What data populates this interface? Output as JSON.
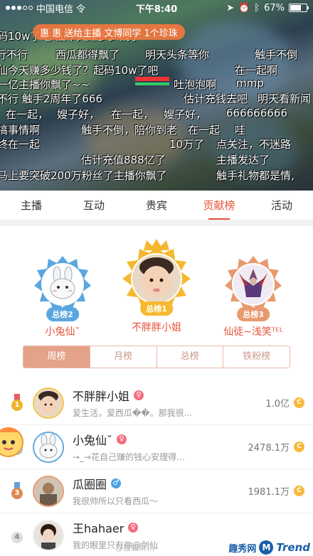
{
  "status_bar": {
    "carrier": "中国电信",
    "network": "令",
    "time": "下午8:40",
    "battery": "67%",
    "battery_level": 0.67
  },
  "video": {
    "gift_banner": "惠 惠 送给主播 文博同学 1个珍珠",
    "danmu": [
      "码10w了吧 仙今天赚多少钱了",
      "行不行",
      "西瓜都得飘了",
      "明天头条等你",
      "触手不倒",
      "仙今天赚多少钱了？起码10w了吧",
      "在一起啊",
      "一亿主播你飘了~~",
      "吐泡泡啊",
      "mmp",
      "不行 触手2周年了666",
      "估计充钱去吧",
      "明天看新闻",
      "在一起，",
      "嫂子好，",
      "在一起，",
      "嫂子好，",
      "666666666",
      "搞事情啊",
      "触手不倒，陪你到老",
      "在一起",
      "哇",
      "终在一起",
      "10万了",
      "点关注，不迷路",
      "估计充值888亿了",
      "主播发达了",
      "马上要突破200万粉丝了主播你飘了",
      "触手礼物都是情,"
    ]
  },
  "tabs": [
    {
      "label": "主播",
      "active": false
    },
    {
      "label": "互动",
      "active": false
    },
    {
      "label": "贵宾",
      "active": false
    },
    {
      "label": "贡献榜",
      "active": true
    },
    {
      "label": "活动",
      "active": false
    }
  ],
  "podium": [
    {
      "rank_label": "总榜2",
      "name": "小兔仙˘",
      "color": "#5aa7e0"
    },
    {
      "rank_label": "总榜1",
      "name": "不胖胖小姐",
      "color": "#f5b82e"
    },
    {
      "rank_label": "总榜3",
      "name": "仙徒~浅笑ᵀᴱᴸ",
      "color": "#e79a6f"
    }
  ],
  "sub_tabs": [
    {
      "label": "周榜",
      "active": true
    },
    {
      "label": "月榜",
      "active": false
    },
    {
      "label": "总榜",
      "active": false
    },
    {
      "label": "铁粉榜",
      "active": false
    }
  ],
  "list": [
    {
      "rank": "1",
      "name": "不胖胖小姐",
      "gender": "female",
      "gender_symbol": "♀",
      "desc": "爱生活，爱西瓜��。那我很...",
      "amount": "1.0亿"
    },
    {
      "rank": "2",
      "name": "小兔仙˘",
      "gender": "female",
      "gender_symbol": "♀",
      "desc": "→_→花自己赚的钱心安理得...",
      "amount": "2478.1万"
    },
    {
      "rank": "3",
      "name": "瓜圈圈",
      "gender": "male",
      "gender_symbol": "♂",
      "desc": "我很帅所以只看西瓜～",
      "amount": "1981.1万"
    },
    {
      "rank": "4",
      "name": "王hahaer",
      "gender": "female",
      "gender_symbol": "♀",
      "desc": "我的眼里只有你@剑仙",
      "amount": ""
    }
  ],
  "coin_symbol": "C",
  "watermark": {
    "site_a": "趣秀网",
    "site_m": "M",
    "site_b": "Trend",
    "weibo": "@搜狐财讯"
  }
}
